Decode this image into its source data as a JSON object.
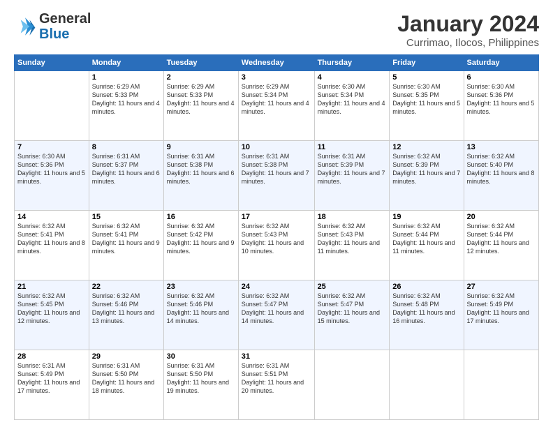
{
  "header": {
    "logo_line1": "General",
    "logo_line2": "Blue",
    "title": "January 2024",
    "subtitle": "Currimao, Ilocos, Philippines"
  },
  "days_of_week": [
    "Sunday",
    "Monday",
    "Tuesday",
    "Wednesday",
    "Thursday",
    "Friday",
    "Saturday"
  ],
  "weeks": [
    [
      {
        "day": "",
        "sunrise": "",
        "sunset": "",
        "daylight": ""
      },
      {
        "day": "1",
        "sunrise": "Sunrise: 6:29 AM",
        "sunset": "Sunset: 5:33 PM",
        "daylight": "Daylight: 11 hours and 4 minutes."
      },
      {
        "day": "2",
        "sunrise": "Sunrise: 6:29 AM",
        "sunset": "Sunset: 5:33 PM",
        "daylight": "Daylight: 11 hours and 4 minutes."
      },
      {
        "day": "3",
        "sunrise": "Sunrise: 6:29 AM",
        "sunset": "Sunset: 5:34 PM",
        "daylight": "Daylight: 11 hours and 4 minutes."
      },
      {
        "day": "4",
        "sunrise": "Sunrise: 6:30 AM",
        "sunset": "Sunset: 5:34 PM",
        "daylight": "Daylight: 11 hours and 4 minutes."
      },
      {
        "day": "5",
        "sunrise": "Sunrise: 6:30 AM",
        "sunset": "Sunset: 5:35 PM",
        "daylight": "Daylight: 11 hours and 5 minutes."
      },
      {
        "day": "6",
        "sunrise": "Sunrise: 6:30 AM",
        "sunset": "Sunset: 5:36 PM",
        "daylight": "Daylight: 11 hours and 5 minutes."
      }
    ],
    [
      {
        "day": "7",
        "sunrise": "Sunrise: 6:30 AM",
        "sunset": "Sunset: 5:36 PM",
        "daylight": "Daylight: 11 hours and 5 minutes."
      },
      {
        "day": "8",
        "sunrise": "Sunrise: 6:31 AM",
        "sunset": "Sunset: 5:37 PM",
        "daylight": "Daylight: 11 hours and 6 minutes."
      },
      {
        "day": "9",
        "sunrise": "Sunrise: 6:31 AM",
        "sunset": "Sunset: 5:38 PM",
        "daylight": "Daylight: 11 hours and 6 minutes."
      },
      {
        "day": "10",
        "sunrise": "Sunrise: 6:31 AM",
        "sunset": "Sunset: 5:38 PM",
        "daylight": "Daylight: 11 hours and 7 minutes."
      },
      {
        "day": "11",
        "sunrise": "Sunrise: 6:31 AM",
        "sunset": "Sunset: 5:39 PM",
        "daylight": "Daylight: 11 hours and 7 minutes."
      },
      {
        "day": "12",
        "sunrise": "Sunrise: 6:32 AM",
        "sunset": "Sunset: 5:39 PM",
        "daylight": "Daylight: 11 hours and 7 minutes."
      },
      {
        "day": "13",
        "sunrise": "Sunrise: 6:32 AM",
        "sunset": "Sunset: 5:40 PM",
        "daylight": "Daylight: 11 hours and 8 minutes."
      }
    ],
    [
      {
        "day": "14",
        "sunrise": "Sunrise: 6:32 AM",
        "sunset": "Sunset: 5:41 PM",
        "daylight": "Daylight: 11 hours and 8 minutes."
      },
      {
        "day": "15",
        "sunrise": "Sunrise: 6:32 AM",
        "sunset": "Sunset: 5:41 PM",
        "daylight": "Daylight: 11 hours and 9 minutes."
      },
      {
        "day": "16",
        "sunrise": "Sunrise: 6:32 AM",
        "sunset": "Sunset: 5:42 PM",
        "daylight": "Daylight: 11 hours and 9 minutes."
      },
      {
        "day": "17",
        "sunrise": "Sunrise: 6:32 AM",
        "sunset": "Sunset: 5:43 PM",
        "daylight": "Daylight: 11 hours and 10 minutes."
      },
      {
        "day": "18",
        "sunrise": "Sunrise: 6:32 AM",
        "sunset": "Sunset: 5:43 PM",
        "daylight": "Daylight: 11 hours and 11 minutes."
      },
      {
        "day": "19",
        "sunrise": "Sunrise: 6:32 AM",
        "sunset": "Sunset: 5:44 PM",
        "daylight": "Daylight: 11 hours and 11 minutes."
      },
      {
        "day": "20",
        "sunrise": "Sunrise: 6:32 AM",
        "sunset": "Sunset: 5:44 PM",
        "daylight": "Daylight: 11 hours and 12 minutes."
      }
    ],
    [
      {
        "day": "21",
        "sunrise": "Sunrise: 6:32 AM",
        "sunset": "Sunset: 5:45 PM",
        "daylight": "Daylight: 11 hours and 12 minutes."
      },
      {
        "day": "22",
        "sunrise": "Sunrise: 6:32 AM",
        "sunset": "Sunset: 5:46 PM",
        "daylight": "Daylight: 11 hours and 13 minutes."
      },
      {
        "day": "23",
        "sunrise": "Sunrise: 6:32 AM",
        "sunset": "Sunset: 5:46 PM",
        "daylight": "Daylight: 11 hours and 14 minutes."
      },
      {
        "day": "24",
        "sunrise": "Sunrise: 6:32 AM",
        "sunset": "Sunset: 5:47 PM",
        "daylight": "Daylight: 11 hours and 14 minutes."
      },
      {
        "day": "25",
        "sunrise": "Sunrise: 6:32 AM",
        "sunset": "Sunset: 5:47 PM",
        "daylight": "Daylight: 11 hours and 15 minutes."
      },
      {
        "day": "26",
        "sunrise": "Sunrise: 6:32 AM",
        "sunset": "Sunset: 5:48 PM",
        "daylight": "Daylight: 11 hours and 16 minutes."
      },
      {
        "day": "27",
        "sunrise": "Sunrise: 6:32 AM",
        "sunset": "Sunset: 5:49 PM",
        "daylight": "Daylight: 11 hours and 17 minutes."
      }
    ],
    [
      {
        "day": "28",
        "sunrise": "Sunrise: 6:31 AM",
        "sunset": "Sunset: 5:49 PM",
        "daylight": "Daylight: 11 hours and 17 minutes."
      },
      {
        "day": "29",
        "sunrise": "Sunrise: 6:31 AM",
        "sunset": "Sunset: 5:50 PM",
        "daylight": "Daylight: 11 hours and 18 minutes."
      },
      {
        "day": "30",
        "sunrise": "Sunrise: 6:31 AM",
        "sunset": "Sunset: 5:50 PM",
        "daylight": "Daylight: 11 hours and 19 minutes."
      },
      {
        "day": "31",
        "sunrise": "Sunrise: 6:31 AM",
        "sunset": "Sunset: 5:51 PM",
        "daylight": "Daylight: 11 hours and 20 minutes."
      },
      {
        "day": "",
        "sunrise": "",
        "sunset": "",
        "daylight": ""
      },
      {
        "day": "",
        "sunrise": "",
        "sunset": "",
        "daylight": ""
      },
      {
        "day": "",
        "sunrise": "",
        "sunset": "",
        "daylight": ""
      }
    ]
  ]
}
